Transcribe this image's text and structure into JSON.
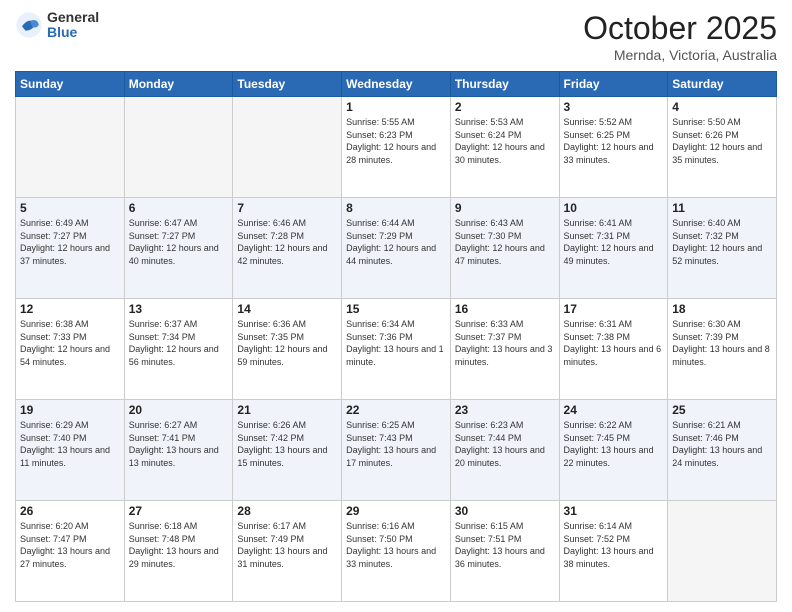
{
  "logo": {
    "general": "General",
    "blue": "Blue"
  },
  "header": {
    "month": "October 2025",
    "location": "Mernda, Victoria, Australia"
  },
  "weekdays": [
    "Sunday",
    "Monday",
    "Tuesday",
    "Wednesday",
    "Thursday",
    "Friday",
    "Saturday"
  ],
  "weeks": [
    [
      {
        "day": "",
        "empty": true
      },
      {
        "day": "",
        "empty": true
      },
      {
        "day": "",
        "empty": true
      },
      {
        "day": "1",
        "sunrise": "5:55 AM",
        "sunset": "6:23 PM",
        "daylight": "12 hours and 28 minutes."
      },
      {
        "day": "2",
        "sunrise": "5:53 AM",
        "sunset": "6:24 PM",
        "daylight": "12 hours and 30 minutes."
      },
      {
        "day": "3",
        "sunrise": "5:52 AM",
        "sunset": "6:25 PM",
        "daylight": "12 hours and 33 minutes."
      },
      {
        "day": "4",
        "sunrise": "5:50 AM",
        "sunset": "6:26 PM",
        "daylight": "12 hours and 35 minutes."
      }
    ],
    [
      {
        "day": "5",
        "sunrise": "6:49 AM",
        "sunset": "7:27 PM",
        "daylight": "12 hours and 37 minutes."
      },
      {
        "day": "6",
        "sunrise": "6:47 AM",
        "sunset": "7:27 PM",
        "daylight": "12 hours and 40 minutes."
      },
      {
        "day": "7",
        "sunrise": "6:46 AM",
        "sunset": "7:28 PM",
        "daylight": "12 hours and 42 minutes."
      },
      {
        "day": "8",
        "sunrise": "6:44 AM",
        "sunset": "7:29 PM",
        "daylight": "12 hours and 44 minutes."
      },
      {
        "day": "9",
        "sunrise": "6:43 AM",
        "sunset": "7:30 PM",
        "daylight": "12 hours and 47 minutes."
      },
      {
        "day": "10",
        "sunrise": "6:41 AM",
        "sunset": "7:31 PM",
        "daylight": "12 hours and 49 minutes."
      },
      {
        "day": "11",
        "sunrise": "6:40 AM",
        "sunset": "7:32 PM",
        "daylight": "12 hours and 52 minutes."
      }
    ],
    [
      {
        "day": "12",
        "sunrise": "6:38 AM",
        "sunset": "7:33 PM",
        "daylight": "12 hours and 54 minutes."
      },
      {
        "day": "13",
        "sunrise": "6:37 AM",
        "sunset": "7:34 PM",
        "daylight": "12 hours and 56 minutes."
      },
      {
        "day": "14",
        "sunrise": "6:36 AM",
        "sunset": "7:35 PM",
        "daylight": "12 hours and 59 minutes."
      },
      {
        "day": "15",
        "sunrise": "6:34 AM",
        "sunset": "7:36 PM",
        "daylight": "13 hours and 1 minute."
      },
      {
        "day": "16",
        "sunrise": "6:33 AM",
        "sunset": "7:37 PM",
        "daylight": "13 hours and 3 minutes."
      },
      {
        "day": "17",
        "sunrise": "6:31 AM",
        "sunset": "7:38 PM",
        "daylight": "13 hours and 6 minutes."
      },
      {
        "day": "18",
        "sunrise": "6:30 AM",
        "sunset": "7:39 PM",
        "daylight": "13 hours and 8 minutes."
      }
    ],
    [
      {
        "day": "19",
        "sunrise": "6:29 AM",
        "sunset": "7:40 PM",
        "daylight": "13 hours and 11 minutes."
      },
      {
        "day": "20",
        "sunrise": "6:27 AM",
        "sunset": "7:41 PM",
        "daylight": "13 hours and 13 minutes."
      },
      {
        "day": "21",
        "sunrise": "6:26 AM",
        "sunset": "7:42 PM",
        "daylight": "13 hours and 15 minutes."
      },
      {
        "day": "22",
        "sunrise": "6:25 AM",
        "sunset": "7:43 PM",
        "daylight": "13 hours and 17 minutes."
      },
      {
        "day": "23",
        "sunrise": "6:23 AM",
        "sunset": "7:44 PM",
        "daylight": "13 hours and 20 minutes."
      },
      {
        "day": "24",
        "sunrise": "6:22 AM",
        "sunset": "7:45 PM",
        "daylight": "13 hours and 22 minutes."
      },
      {
        "day": "25",
        "sunrise": "6:21 AM",
        "sunset": "7:46 PM",
        "daylight": "13 hours and 24 minutes."
      }
    ],
    [
      {
        "day": "26",
        "sunrise": "6:20 AM",
        "sunset": "7:47 PM",
        "daylight": "13 hours and 27 minutes."
      },
      {
        "day": "27",
        "sunrise": "6:18 AM",
        "sunset": "7:48 PM",
        "daylight": "13 hours and 29 minutes."
      },
      {
        "day": "28",
        "sunrise": "6:17 AM",
        "sunset": "7:49 PM",
        "daylight": "13 hours and 31 minutes."
      },
      {
        "day": "29",
        "sunrise": "6:16 AM",
        "sunset": "7:50 PM",
        "daylight": "13 hours and 33 minutes."
      },
      {
        "day": "30",
        "sunrise": "6:15 AM",
        "sunset": "7:51 PM",
        "daylight": "13 hours and 36 minutes."
      },
      {
        "day": "31",
        "sunrise": "6:14 AM",
        "sunset": "7:52 PM",
        "daylight": "13 hours and 38 minutes."
      },
      {
        "day": "",
        "empty": true
      }
    ]
  ]
}
